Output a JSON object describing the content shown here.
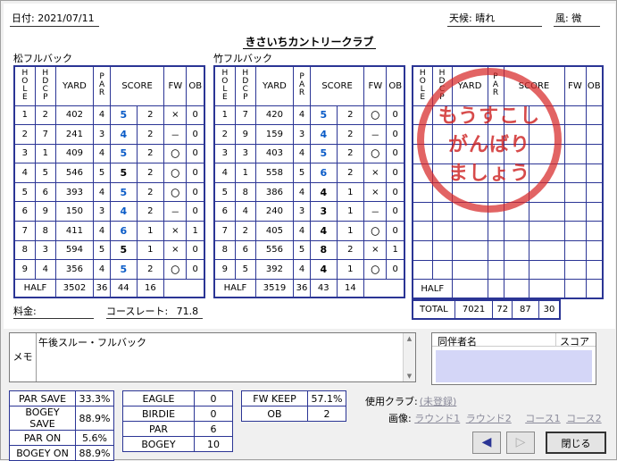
{
  "header": {
    "date": "日付: 2021/07/11",
    "weather": "天候: 晴れ",
    "wind": "風: 微"
  },
  "course_name": "きさいちカントリークラブ",
  "colors": {
    "border": "#2b3595",
    "score_blue": "#0a5bc7",
    "stamp": "#d72828",
    "companion_bg": "#d4d6f7"
  },
  "sections": [
    {
      "name": "松フルバック",
      "half_label": "HALF",
      "half_yard": "3502",
      "half_par": "36",
      "half_score": "44",
      "half_putt": "16",
      "holes": [
        [
          "1",
          "2",
          "402",
          "4",
          "5",
          "2",
          "×",
          "0",
          true
        ],
        [
          "2",
          "7",
          "241",
          "3",
          "4",
          "2",
          "－",
          "0",
          true
        ],
        [
          "3",
          "1",
          "409",
          "4",
          "5",
          "2",
          "〇",
          "0",
          true
        ],
        [
          "4",
          "5",
          "546",
          "5",
          "5",
          "2",
          "〇",
          "0",
          false
        ],
        [
          "5",
          "6",
          "393",
          "4",
          "5",
          "2",
          "〇",
          "0",
          true
        ],
        [
          "6",
          "9",
          "150",
          "3",
          "4",
          "2",
          "－",
          "0",
          true
        ],
        [
          "7",
          "8",
          "411",
          "4",
          "6",
          "1",
          "×",
          "1",
          true
        ],
        [
          "8",
          "3",
          "594",
          "5",
          "5",
          "1",
          "×",
          "0",
          false
        ],
        [
          "9",
          "4",
          "356",
          "4",
          "5",
          "2",
          "〇",
          "0",
          true
        ]
      ]
    },
    {
      "name": "竹フルバック",
      "half_label": "HALF",
      "half_yard": "3519",
      "half_par": "36",
      "half_score": "43",
      "half_putt": "14",
      "holes": [
        [
          "1",
          "7",
          "420",
          "4",
          "5",
          "2",
          "〇",
          "0",
          true
        ],
        [
          "2",
          "9",
          "159",
          "3",
          "4",
          "2",
          "－",
          "0",
          true
        ],
        [
          "3",
          "3",
          "403",
          "4",
          "5",
          "2",
          "〇",
          "0",
          true
        ],
        [
          "4",
          "1",
          "558",
          "5",
          "6",
          "2",
          "×",
          "0",
          true
        ],
        [
          "5",
          "8",
          "386",
          "4",
          "4",
          "1",
          "×",
          "0",
          false
        ],
        [
          "6",
          "4",
          "240",
          "3",
          "3",
          "1",
          "－",
          "0",
          false
        ],
        [
          "7",
          "2",
          "405",
          "4",
          "4",
          "1",
          "〇",
          "0",
          false
        ],
        [
          "8",
          "6",
          "556",
          "5",
          "8",
          "2",
          "×",
          "1",
          false
        ],
        [
          "9",
          "5",
          "392",
          "4",
          "4",
          "1",
          "〇",
          "0",
          false
        ]
      ]
    }
  ],
  "headers": {
    "hole": "HOLE",
    "hdcp": "HDCP",
    "yard": "YARD",
    "par": "PAR",
    "score": "SCORE",
    "fw": "FW",
    "ob": "OB"
  },
  "third": {
    "half_label": "HALF",
    "total_label": "TOTAL",
    "total_yard": "7021",
    "total_par": "72",
    "total_score": "87",
    "total_putt": "30"
  },
  "stamp": {
    "line1": "もうすこし",
    "line2": "がんばり",
    "line3": "ましょう"
  },
  "fee": "料金:",
  "course_rate_label": "コースレート:",
  "course_rate": "71.8",
  "memo": {
    "label": "メモ",
    "text": "午後スルー・フルバック"
  },
  "companions": {
    "col1": "同伴者名",
    "col2": "スコア"
  },
  "stats1": [
    [
      "PAR SAVE",
      "33.3%"
    ],
    [
      "BOGEY SAVE",
      "88.9%"
    ],
    [
      "PAR ON",
      "5.6%"
    ],
    [
      "BOGEY ON",
      "88.9%"
    ]
  ],
  "stats2": [
    [
      "EAGLE",
      "0"
    ],
    [
      "BIRDIE",
      "0"
    ],
    [
      "PAR",
      "6"
    ],
    [
      "BOGEY",
      "10"
    ]
  ],
  "stats3": [
    [
      "FW KEEP",
      "57.1%"
    ],
    [
      "OB",
      "2"
    ]
  ],
  "clubs_label": "使用クラブ:",
  "clubs_value": "(未登録)",
  "image_label": "画像:",
  "image_links": [
    "ラウンド1",
    "ラウンド2",
    "コース1",
    "コース2"
  ],
  "close_label": "閉じる"
}
